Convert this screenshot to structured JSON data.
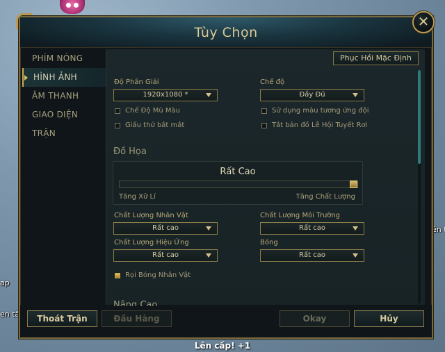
{
  "background": {
    "left_texts": [
      "ap",
      "en tấn"
    ],
    "right_text": "ên t",
    "level_up": "Lên cấp! +1"
  },
  "dialog": {
    "title": "Tùy Chọn",
    "close_glyph": "✕"
  },
  "sidebar": {
    "items": [
      {
        "label": "PHÍM NÓNG",
        "active": false
      },
      {
        "label": "HÌNH ẢNH",
        "active": true
      },
      {
        "label": "ÂM THANH",
        "active": false
      },
      {
        "label": "GIAO DIỆN",
        "active": false
      },
      {
        "label": "TRẬN",
        "active": false
      }
    ]
  },
  "toolbar": {
    "reset_label": "Phục Hồi Mặc Định"
  },
  "display": {
    "resolution_label": "Độ Phân Giải",
    "resolution_value": "1920x1080 *",
    "mode_label": "Chế độ",
    "mode_value": "Đầy Đủ",
    "colorblind_label": "Chế Độ Mù Màu",
    "colorblind_checked": false,
    "hide_eye_candy_label": "Giấu thứ bắt mắt",
    "hide_eye_candy_checked": false,
    "team_colors_label": "Sử dụng màu tương ứng đội",
    "team_colors_checked": false,
    "festival_map_label": "Tắt bản đồ Lễ Hội Tuyết Rơi",
    "festival_map_checked": false
  },
  "graphics": {
    "section_title": "Đồ Họa",
    "quality_value": "Rất Cao",
    "slider_level": 1.0,
    "slider_left_label": "Tăng Xử Lí",
    "slider_right_label": "Tăng Chất Lượng",
    "character_quality_label": "Chất Lượng Nhân Vật",
    "character_quality_value": "Rất cao",
    "environment_quality_label": "Chất Lượng Môi Trường",
    "environment_quality_value": "Rất cao",
    "effects_quality_label": "Chất Lượng Hiệu Ứng",
    "effects_quality_value": "Rất cao",
    "shadows_label": "Bóng",
    "shadows_value": "Rất cao",
    "character_shadows_label": "Rọi Bóng Nhân Vật",
    "character_shadows_checked": true
  },
  "advanced": {
    "section_title": "Nâng Cao"
  },
  "footer": {
    "exit_label": "Thoát Trận",
    "surrender_label": "Đầu Hàng",
    "okay_label": "Okay",
    "cancel_label": "Hủy"
  },
  "colors": {
    "accent_gold": "#c9a94f",
    "panel_bg": "#1b272a",
    "scroll_teal": "#2f7a7d"
  }
}
